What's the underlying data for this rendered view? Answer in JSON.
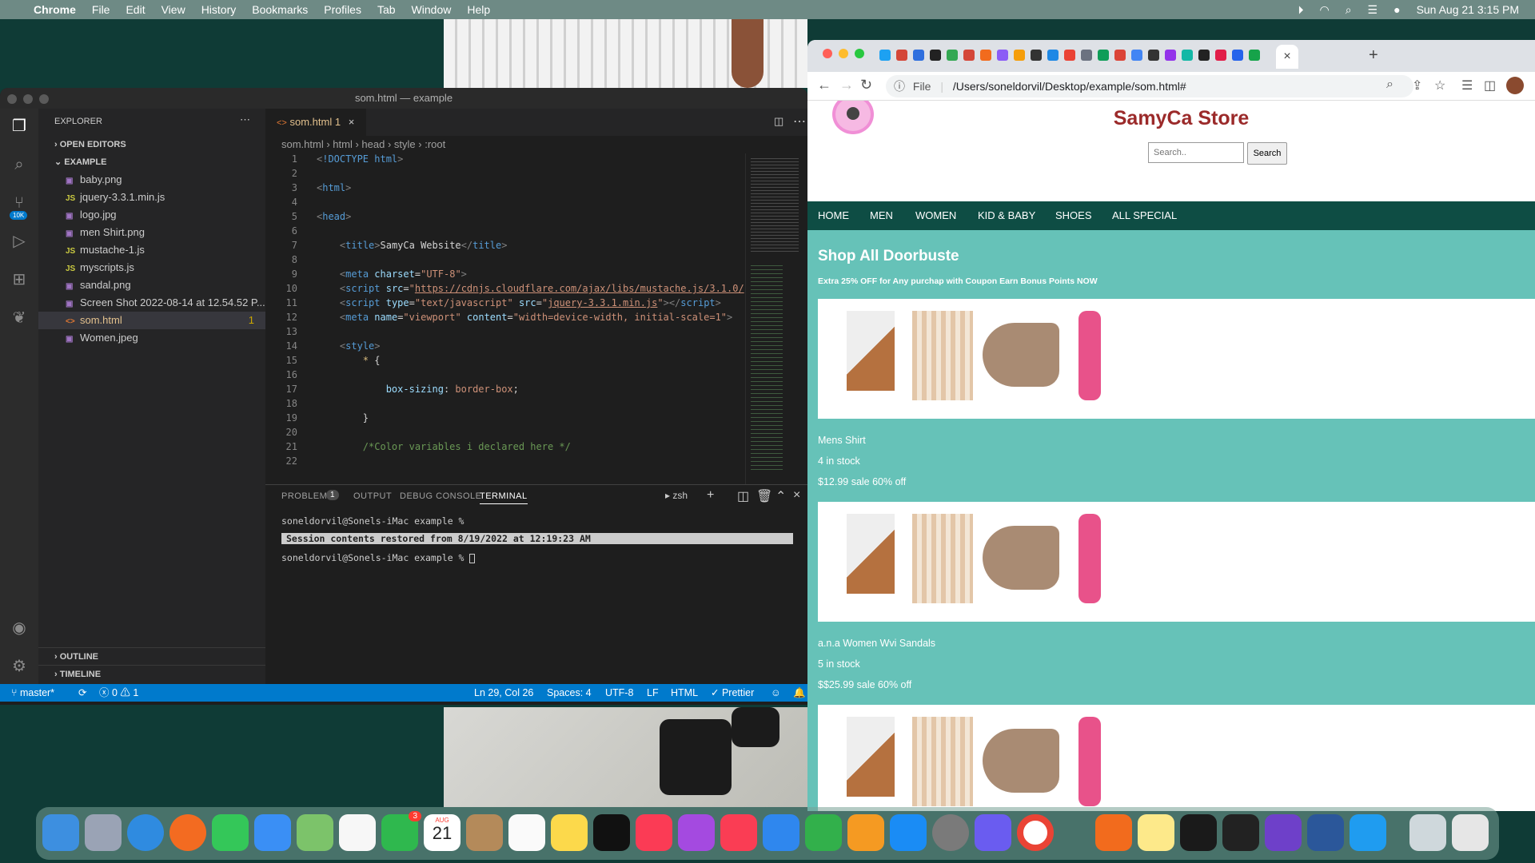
{
  "menubar": {
    "app": "Chrome",
    "items": [
      "File",
      "Edit",
      "View",
      "History",
      "Bookmarks",
      "Profiles",
      "Tab",
      "Window",
      "Help"
    ],
    "clock": "Sun Aug 21  3:15 PM"
  },
  "vscode": {
    "title": "som.html — example",
    "badge_count": "10K",
    "explorer": {
      "header": "EXPLORER",
      "open_editors": "OPEN EDITORS",
      "folder": "EXAMPLE",
      "outline": "OUTLINE",
      "timeline": "TIMELINE",
      "files": [
        {
          "name": "baby.png",
          "icon": "image-icon"
        },
        {
          "name": "jquery-3.3.1.min.js",
          "icon": "js-icon"
        },
        {
          "name": "logo.jpg",
          "icon": "image-icon"
        },
        {
          "name": "men Shirt.png",
          "icon": "image-icon"
        },
        {
          "name": "mustache-1.js",
          "icon": "js-icon"
        },
        {
          "name": "myscripts.js",
          "icon": "js-icon"
        },
        {
          "name": "sandal.png",
          "icon": "image-icon"
        },
        {
          "name": "Screen Shot 2022-08-14 at 12.54.52 P...",
          "icon": "image-icon"
        },
        {
          "name": "som.html",
          "icon": "html-icon",
          "badge": "1"
        },
        {
          "name": "Women.jpeg",
          "icon": "image-icon"
        }
      ]
    },
    "tab": {
      "label": "som.html",
      "badge": "1"
    },
    "breadcrumb": [
      "som.html",
      "html",
      "head",
      "style",
      ":root"
    ],
    "line_numbers": [
      "1",
      "2",
      "3",
      "4",
      "5",
      "6",
      "7",
      "8",
      "9",
      "10",
      "11",
      "12",
      "13",
      "14",
      "15",
      "16",
      "17",
      "18",
      "19",
      "20",
      "21",
      "22"
    ],
    "panel": {
      "tabs": [
        "PROBLEMS",
        "OUTPUT",
        "DEBUG CONSOLE",
        "TERMINAL"
      ],
      "problems_count": "1",
      "shell": "zsh",
      "terminal": [
        "soneldorvil@Sonels-iMac example %",
        "Session contents restored from 8/19/2022 at 12:19:23 AM",
        "soneldorvil@Sonels-iMac example %"
      ]
    },
    "status": {
      "branch": "master*",
      "errors": "0",
      "warnings": "1",
      "position": "Ln 29, Col 26",
      "spaces": "Spaces: 4",
      "encoding": "UTF-8",
      "eol": "LF",
      "lang": "HTML",
      "formatter": "Prettier"
    }
  },
  "chrome": {
    "url_label": "File",
    "url": "/Users/soneldorvil/Desktop/example/som.html#"
  },
  "store": {
    "title": "SamyCa Store",
    "search_placeholder": "Search..",
    "search_button": "Search",
    "nav": [
      "HOME",
      "MEN",
      "WOMEN",
      "KID & BABY",
      "SHOES",
      "ALL SPECIAL"
    ],
    "heading": "Shop All Doorbuste",
    "promo": "Extra 25% OFF for Any purchap with Coupon Earn Bonus Points NOW",
    "products": [
      {
        "name": "Mens Shirt",
        "stock": "4 in stock",
        "price": "$12.99 sale 60% off"
      },
      {
        "name": "a.n.a Women Wvi Sandals",
        "stock": "5 in stock",
        "price": "$$25.99 sale 60% off"
      }
    ],
    "colors": {
      "nav": "#0e4d44",
      "shop_bg": "#66c2b8",
      "title": "#9b2a2a"
    }
  },
  "dock": {
    "calendar_month": "AUG",
    "calendar_day": "21",
    "facetime_badge": "3"
  }
}
